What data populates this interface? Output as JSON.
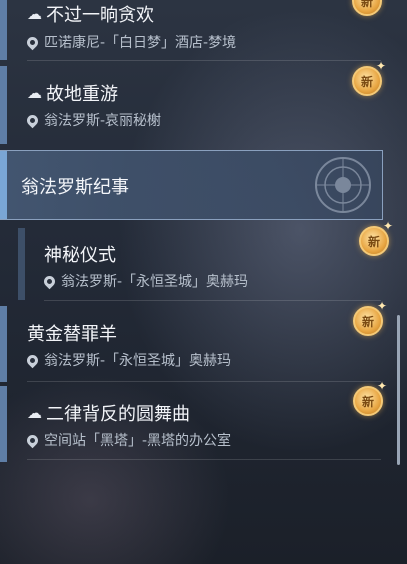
{
  "quests": [
    {
      "title": "不过一晌贪欢",
      "location": "匹诺康尼-「白日梦」酒店-梦境",
      "icon": "dream-bubble-icon",
      "badge": "新"
    },
    {
      "title": "故地重游",
      "location": "翁法罗斯-哀丽秘榭",
      "icon": "dream-bubble-icon",
      "badge": "新"
    }
  ],
  "section": {
    "label": "翁法罗斯纪事",
    "emblem": "amphoreus-emblem-icon"
  },
  "sub_quests": [
    {
      "title": "神秘仪式",
      "location": "翁法罗斯-「永恒圣城」奥赫玛",
      "badge": "新"
    }
  ],
  "more_quests": [
    {
      "title": "黄金替罪羊",
      "location": "翁法罗斯-「永恒圣城」奥赫玛",
      "badge": "新"
    },
    {
      "title": "二律背反的圆舞曲",
      "location": "空间站「黑塔」-黑塔的办公室",
      "icon": "dream-bubble-icon",
      "badge": "新"
    }
  ],
  "colors": {
    "badge": "#e8a643",
    "accent": "#7aa6d6",
    "bar": "#5f7ea6"
  }
}
